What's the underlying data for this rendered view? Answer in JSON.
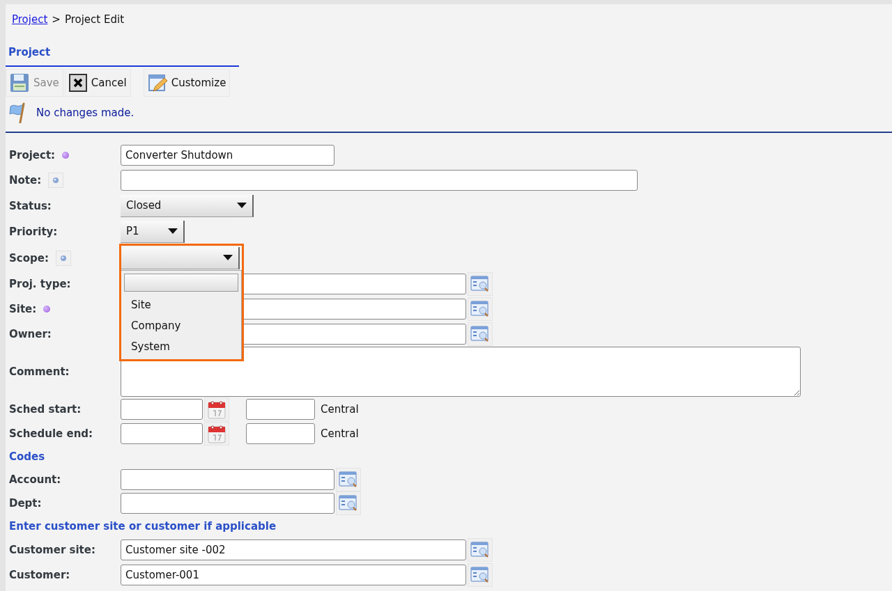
{
  "breadcrumb": {
    "link": "Project",
    "separator": ">",
    "current": "Project Edit"
  },
  "section_title": "Project",
  "toolbar": [
    {
      "label": "Save",
      "kind": "save",
      "disabled": true
    },
    {
      "label": "Cancel",
      "kind": "cancel",
      "disabled": false
    },
    {
      "label": "Customize",
      "kind": "customize",
      "disabled": false
    }
  ],
  "message": "No changes made.",
  "fields": [
    {
      "label": "Project:",
      "required": true,
      "help": false,
      "kind": "text",
      "value": "Converter Shutdown"
    },
    {
      "label": "Note:",
      "required": false,
      "help": true,
      "kind": "note"
    },
    {
      "label": "Status:",
      "required": false,
      "help": false,
      "kind": "select",
      "value": "Closed"
    },
    {
      "label": "Priority:",
      "required": false,
      "help": false,
      "kind": "select-small",
      "value": "P1"
    },
    {
      "label": "Scope:",
      "required": false,
      "help": true,
      "kind": "select-open",
      "highlighted": true,
      "options": [
        "Site",
        "Company",
        "System"
      ]
    },
    {
      "label": "Proj. type:",
      "required": false,
      "help": false,
      "kind": "lookup"
    },
    {
      "label": "Site:",
      "required": true,
      "help": false,
      "kind": "lookup"
    },
    {
      "label": "Owner:",
      "required": false,
      "help": false,
      "kind": "lookup"
    },
    {
      "label": "Comment:",
      "required": false,
      "help": false,
      "kind": "textarea"
    },
    {
      "label": "Sched start:",
      "required": false,
      "help": false,
      "kind": "datetime",
      "zone": "Central"
    },
    {
      "label": "Schedule end:",
      "required": false,
      "help": false,
      "kind": "datetime",
      "zone": "Central"
    },
    {
      "label": "Codes",
      "kind": "heading"
    },
    {
      "label": "Account:",
      "required": false,
      "help": false,
      "kind": "code-lookup"
    },
    {
      "label": "Dept:",
      "required": false,
      "help": false,
      "kind": "code-lookup"
    },
    {
      "label": "Enter customer site or customer if applicable",
      "kind": "heading"
    },
    {
      "label": "Customer site:",
      "required": false,
      "help": false,
      "kind": "lookup",
      "value": "Customer site -002"
    },
    {
      "label": "Customer:",
      "required": false,
      "help": false,
      "kind": "lookup",
      "value": "Customer-001"
    }
  ]
}
